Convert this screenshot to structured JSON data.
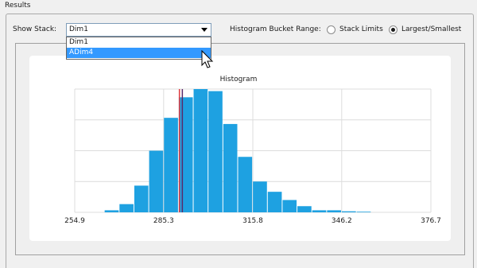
{
  "results_title": "Results",
  "show_stack": {
    "label": "Show Stack:",
    "selected_value": "Dim1",
    "options": [
      "Dim1",
      "ADim4"
    ],
    "highlighted_option": "ADim4"
  },
  "bucket_range": {
    "label": "Histogram Bucket Range:",
    "options": [
      {
        "label": "Stack Limits",
        "checked": false
      },
      {
        "label": "Largest/Smallest",
        "checked": true
      }
    ]
  },
  "colors": {
    "bar": "#1ea1e1",
    "marker_red": "#e0393e",
    "marker_dark": "#5a2a6a",
    "gridline": "#dcdcdc",
    "selection": "#3399ff"
  },
  "chart_data": {
    "type": "bar",
    "title": "Histogram",
    "xlabel": "",
    "ylabel": "",
    "xlim": [
      254.9,
      376.7
    ],
    "x_ticks": [
      "254.9",
      "285.3",
      "315.8",
      "346.2",
      "376.7"
    ],
    "bin_width": 5.07,
    "bin_start": 265.0,
    "values": [
      1,
      4,
      13,
      30,
      46,
      56,
      60,
      59,
      43,
      27,
      15,
      10,
      6,
      3,
      1,
      1,
      0.5,
      0.3
    ],
    "ylim": [
      0,
      60
    ],
    "markers": [
      {
        "name": "marker",
        "x": 290.7
      },
      {
        "name": "marker",
        "x": 291.7
      }
    ],
    "grid": true
  }
}
